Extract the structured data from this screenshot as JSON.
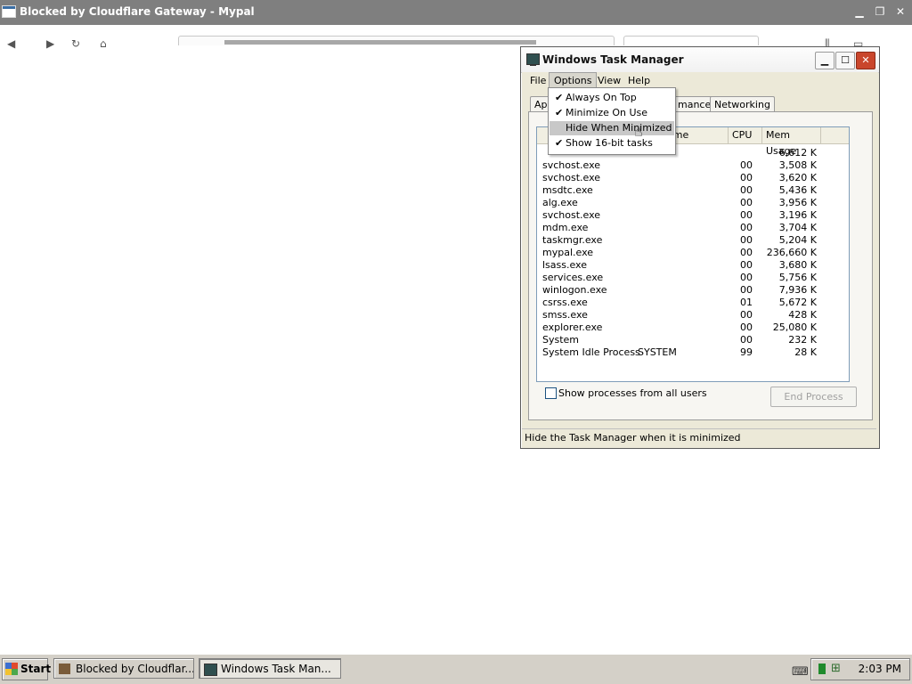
{
  "browser": {
    "title": "Blocked by Cloudflare Gateway - Mypal"
  },
  "taskmanager": {
    "title": "Windows Task Manager",
    "menus": [
      "File",
      "Options",
      "View",
      "Help"
    ],
    "tabs": {
      "applications_partial": "App",
      "performance_partial": "mance",
      "networking": "Networking"
    },
    "columns": {
      "image_name_partial": "ame",
      "cpu": "CPU",
      "mem": "Mem Usage"
    },
    "processes": [
      {
        "name": "svchost.exe",
        "user": "",
        "cpu": "00",
        "mem": "3,508 K"
      },
      {
        "name": "svchost.exe",
        "user": "",
        "cpu": "00",
        "mem": "3,620 K"
      },
      {
        "name": "msdtc.exe",
        "user": "",
        "cpu": "00",
        "mem": "5,436 K"
      },
      {
        "name": "alg.exe",
        "user": "",
        "cpu": "00",
        "mem": "3,956 K"
      },
      {
        "name": "svchost.exe",
        "user": "",
        "cpu": "00",
        "mem": "3,196 K"
      },
      {
        "name": "mdm.exe",
        "user": "",
        "cpu": "00",
        "mem": "3,704 K"
      },
      {
        "name": "taskmgr.exe",
        "user": "",
        "cpu": "00",
        "mem": "5,204 K"
      },
      {
        "name": "mypal.exe",
        "user": "",
        "cpu": "00",
        "mem": "236,660 K"
      },
      {
        "name": "lsass.exe",
        "user": "",
        "cpu": "00",
        "mem": "3,680 K"
      },
      {
        "name": "services.exe",
        "user": "",
        "cpu": "00",
        "mem": "5,756 K"
      },
      {
        "name": "winlogon.exe",
        "user": "",
        "cpu": "00",
        "mem": "7,936 K"
      },
      {
        "name": "csrss.exe",
        "user": "",
        "cpu": "01",
        "mem": "5,672 K"
      },
      {
        "name": "smss.exe",
        "user": "",
        "cpu": "00",
        "mem": "428 K"
      },
      {
        "name": "explorer.exe",
        "user": "",
        "cpu": "00",
        "mem": "25,080 K"
      },
      {
        "name": "System",
        "user": "",
        "cpu": "00",
        "mem": "232 K"
      },
      {
        "name": "System Idle Process",
        "user": "SYSTEM",
        "cpu": "99",
        "mem": "28 K"
      }
    ],
    "partial_first_row": {
      "cpu": "",
      "mem": "6,612 K"
    },
    "show_all_users_label": "Show processes from all users",
    "end_process_label": "End Process",
    "status_text": "Hide the Task Manager when it is minimized"
  },
  "options_menu": {
    "items": [
      {
        "label": "Always On Top",
        "checked": true,
        "highlighted": false
      },
      {
        "label": "Minimize On Use",
        "checked": true,
        "highlighted": false
      },
      {
        "label": "Hide When Minimized",
        "checked": false,
        "highlighted": true
      },
      {
        "label": "Show 16-bit tasks",
        "checked": true,
        "highlighted": false
      }
    ]
  },
  "taskbar": {
    "start_label": "Start",
    "buttons": [
      {
        "label": "Blocked by Cloudflar...",
        "active": false
      },
      {
        "label": "Windows Task Man...",
        "active": true
      }
    ],
    "clock": "2:03 PM"
  }
}
